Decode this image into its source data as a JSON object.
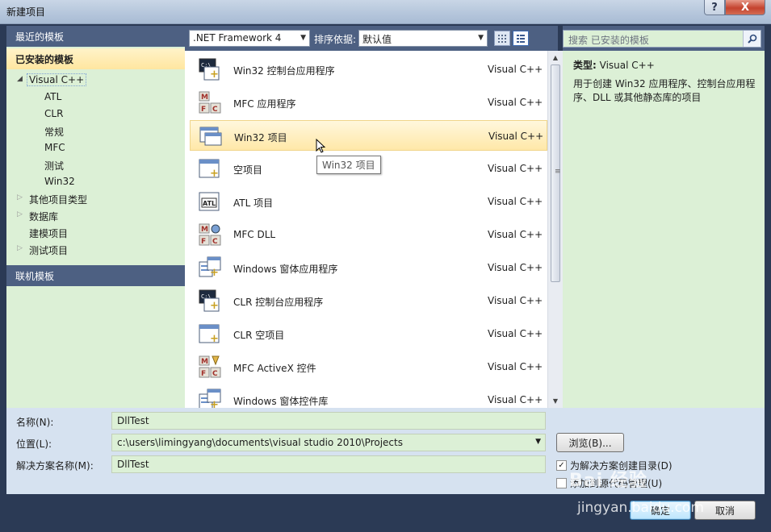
{
  "window": {
    "title": "新建项目",
    "help_label": "?",
    "close_label": "X"
  },
  "sidebar": {
    "recent_label": "最近的模板",
    "installed_label": "已安装的模板",
    "online_label": "联机模板",
    "tree": [
      {
        "label": "Visual C++",
        "level": 0,
        "arrow": "◢",
        "selected": true
      },
      {
        "label": "ATL",
        "level": 1
      },
      {
        "label": "CLR",
        "level": 1
      },
      {
        "label": "常规",
        "level": 1
      },
      {
        "label": "MFC",
        "level": 1
      },
      {
        "label": "测试",
        "level": 1
      },
      {
        "label": "Win32",
        "level": 1
      },
      {
        "label": "其他项目类型",
        "level": 0,
        "arrow": "▷"
      },
      {
        "label": "数据库",
        "level": 0,
        "arrow": "▷"
      },
      {
        "label": "建模项目",
        "level": 0
      },
      {
        "label": "测试项目",
        "level": 0,
        "arrow": "▷"
      }
    ]
  },
  "toolbar": {
    "framework": ".NET Framework 4",
    "sort_label": "排序依据:",
    "sort_value": "默认值"
  },
  "search": {
    "placeholder": "搜索 已安装的模板"
  },
  "templates": [
    {
      "name": "Win32 控制台应用程序",
      "lang": "Visual C++",
      "icon": "console"
    },
    {
      "name": "MFC 应用程序",
      "lang": "Visual C++",
      "icon": "mfc"
    },
    {
      "name": "Win32 项目",
      "lang": "Visual C++",
      "icon": "window",
      "hover": true
    },
    {
      "name": "空项目",
      "lang": "Visual C++",
      "icon": "empty"
    },
    {
      "name": "ATL 项目",
      "lang": "Visual C++",
      "icon": "atl"
    },
    {
      "name": "MFC DLL",
      "lang": "Visual C++",
      "icon": "mfcdll"
    },
    {
      "name": "Windows 窗体应用程序",
      "lang": "Visual C++",
      "icon": "form"
    },
    {
      "name": "CLR 控制台应用程序",
      "lang": "Visual C++",
      "icon": "console"
    },
    {
      "name": "CLR 空项目",
      "lang": "Visual C++",
      "icon": "empty"
    },
    {
      "name": "MFC ActiveX 控件",
      "lang": "Visual C++",
      "icon": "mfcax"
    },
    {
      "name": "Windows 窗体控件库",
      "lang": "Visual C++",
      "icon": "form"
    }
  ],
  "tooltip": "Win32 项目",
  "info": {
    "type_label": "类型:",
    "type_value": "Visual C++",
    "description": "用于创建 Win32 应用程序、控制台应用程序、DLL 或其他静态库的项目"
  },
  "form": {
    "name_label": "名称(N):",
    "name_value": "DllTest",
    "location_label": "位置(L):",
    "location_value": "c:\\users\\limingyang\\documents\\visual studio 2010\\Projects",
    "solution_label": "解决方案名称(M):",
    "solution_value": "DllTest",
    "browse_label": "浏览(B)...",
    "create_dir_label": "为解决方案创建目录(D)",
    "create_dir_checked": true,
    "add_sc_label": "添加到源代码管理(U)",
    "add_sc_checked": false,
    "ok_label": "确定",
    "cancel_label": "取消"
  },
  "watermark": {
    "brand": "Bai 经验",
    "url": "jingyan.baidu.com"
  }
}
